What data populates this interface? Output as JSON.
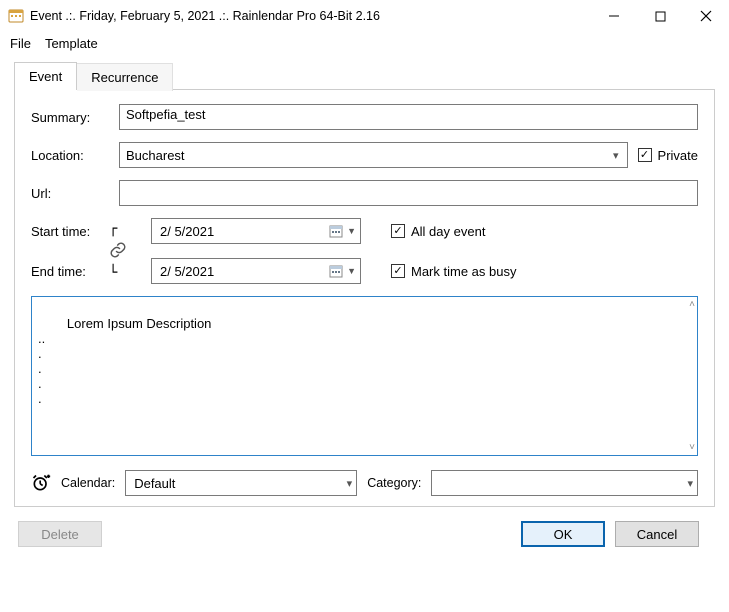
{
  "title": "Event .:. Friday, February 5, 2021 .:. Rainlendar Pro 64-Bit 2.16",
  "menu": {
    "file": "File",
    "template": "Template"
  },
  "tabs": {
    "event": "Event",
    "recurrence": "Recurrence"
  },
  "labels": {
    "summary": "Summary:",
    "location": "Location:",
    "url": "Url:",
    "start": "Start time:",
    "end": "End time:",
    "private": "Private",
    "allday": "All day event",
    "busy": "Mark time as busy",
    "calendar": "Calendar:",
    "category": "Category:"
  },
  "values": {
    "summary": "Softpefia_test",
    "location": "Bucharest",
    "url": "",
    "start_date": "2/ 5/2021",
    "end_date": "2/ 5/2021",
    "description": "Lorem Ipsum Description\n..\n.\n.\n.\n.",
    "calendar": "Default",
    "category": ""
  },
  "checks": {
    "private": true,
    "allday": true,
    "busy": true
  },
  "buttons": {
    "delete": "Delete",
    "ok": "OK",
    "cancel": "Cancel"
  }
}
